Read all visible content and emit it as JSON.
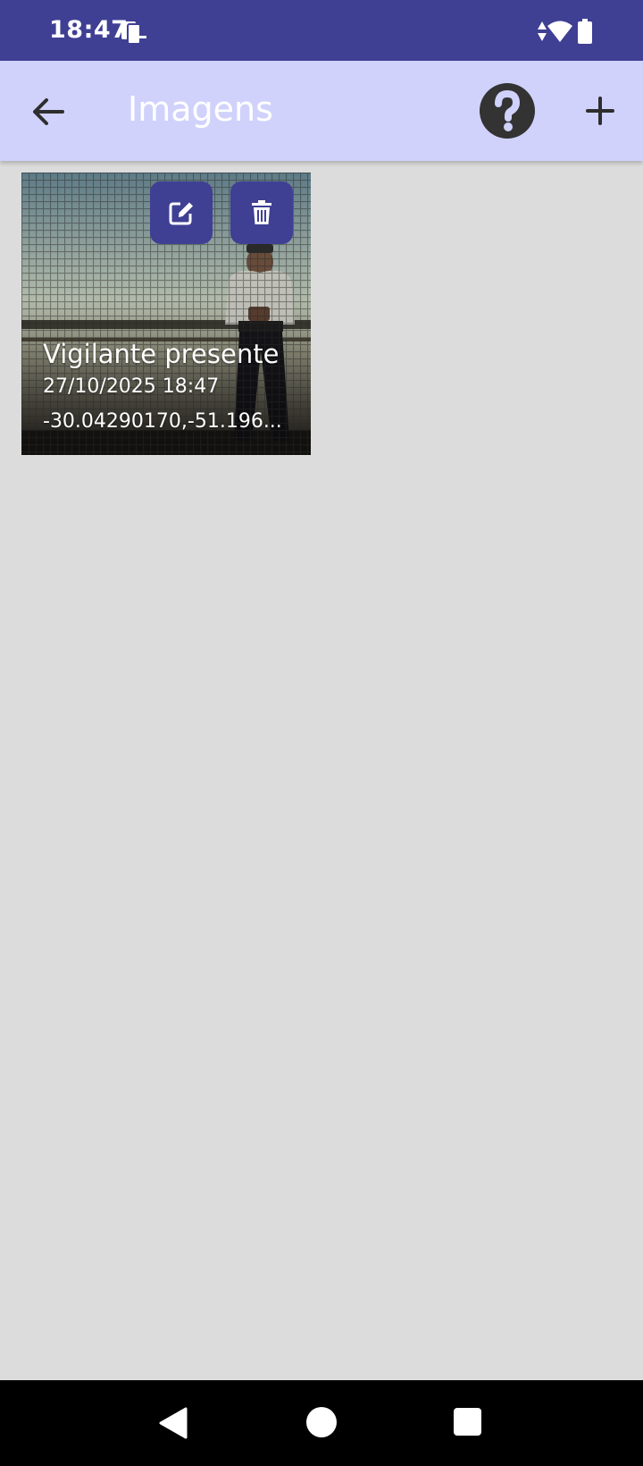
{
  "status_bar": {
    "time": "18:47",
    "icons": [
      "notification-icon",
      "data-arrows-icon",
      "wifi-icon",
      "battery-icon"
    ],
    "background": "#3f3f94"
  },
  "app_bar": {
    "title": "Imagens",
    "background": "#d0d2fc",
    "back_icon": "arrow-left-icon",
    "help_icon": "question-circle-icon",
    "add_icon": "plus-icon"
  },
  "images": [
    {
      "title": "Vigilante presente",
      "date": "27/10/2025 18:47",
      "coordinates": "-30.04290170,-51.196...",
      "edit_icon": "edit-icon",
      "delete_icon": "trash-icon"
    }
  ],
  "colors": {
    "accent": "#3f3f94",
    "content_background": "#dcdcdc"
  },
  "nav_bar": {
    "buttons": [
      "back-triangle-icon",
      "home-circle-icon",
      "recents-square-icon"
    ]
  }
}
